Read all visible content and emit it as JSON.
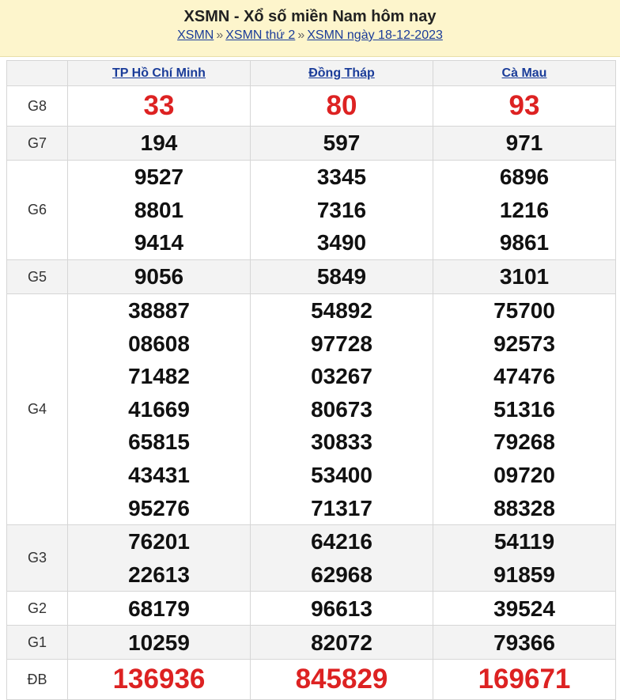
{
  "header": {
    "title": "XSMN - Xổ số miền Nam hôm nay",
    "breadcrumb": [
      {
        "label": "XSMN"
      },
      {
        "label": "XSMN thứ 2"
      },
      {
        "label": "XSMN ngày 18-12-2023"
      }
    ],
    "separator": "»"
  },
  "provinces": [
    "TP Hồ Chí Minh",
    "Đồng Tháp",
    "Cà Mau"
  ],
  "prizes": [
    {
      "label": "G8",
      "values": [
        [
          "33"
        ],
        [
          "80"
        ],
        [
          "93"
        ]
      ]
    },
    {
      "label": "G7",
      "values": [
        [
          "194"
        ],
        [
          "597"
        ],
        [
          "971"
        ]
      ]
    },
    {
      "label": "G6",
      "values": [
        [
          "9527",
          "8801",
          "9414"
        ],
        [
          "3345",
          "7316",
          "3490"
        ],
        [
          "6896",
          "1216",
          "9861"
        ]
      ]
    },
    {
      "label": "G5",
      "values": [
        [
          "9056"
        ],
        [
          "5849"
        ],
        [
          "3101"
        ]
      ]
    },
    {
      "label": "G4",
      "values": [
        [
          "38887",
          "08608",
          "71482",
          "41669",
          "65815",
          "43431",
          "95276"
        ],
        [
          "54892",
          "97728",
          "03267",
          "80673",
          "30833",
          "53400",
          "71317"
        ],
        [
          "75700",
          "92573",
          "47476",
          "51316",
          "79268",
          "09720",
          "88328"
        ]
      ]
    },
    {
      "label": "G3",
      "values": [
        [
          "76201",
          "22613"
        ],
        [
          "64216",
          "62968"
        ],
        [
          "54119",
          "91859"
        ]
      ]
    },
    {
      "label": "G2",
      "values": [
        [
          "68179"
        ],
        [
          "96613"
        ],
        [
          "39524"
        ]
      ]
    },
    {
      "label": "G1",
      "values": [
        [
          "10259"
        ],
        [
          "82072"
        ],
        [
          "79366"
        ]
      ]
    },
    {
      "label": "ĐB",
      "values": [
        [
          "136936"
        ],
        [
          "845829"
        ],
        [
          "169671"
        ]
      ]
    }
  ]
}
